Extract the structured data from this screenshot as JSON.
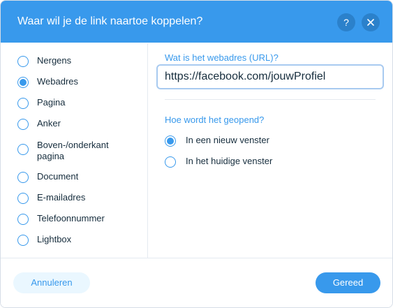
{
  "header": {
    "title": "Waar wil je de link naartoe koppelen?",
    "help_label": "?",
    "help_icon": "help-icon",
    "close_icon": "close-icon",
    "background_color": "#3899ec"
  },
  "link_types": {
    "selected": "Webadres",
    "items": [
      {
        "label": "Nergens",
        "checked": false
      },
      {
        "label": "Webadres",
        "checked": true
      },
      {
        "label": "Pagina",
        "checked": false
      },
      {
        "label": "Anker",
        "checked": false
      },
      {
        "label": "Boven-/onderkant pagina",
        "checked": false
      },
      {
        "label": "Document",
        "checked": false
      },
      {
        "label": "E-mailadres",
        "checked": false
      },
      {
        "label": "Telefoonnummer",
        "checked": false
      },
      {
        "label": "Lightbox",
        "checked": false
      }
    ]
  },
  "url_section": {
    "label": "Wat is het webadres (URL)?",
    "value": "https://facebook.com/jouwProfiel"
  },
  "open_section": {
    "label": "Hoe wordt het geopend?",
    "selected": "In een nieuw venster",
    "options": [
      {
        "label": "In een nieuw venster",
        "checked": true
      },
      {
        "label": "In het huidige venster",
        "checked": false
      }
    ]
  },
  "footer": {
    "cancel_label": "Annuleren",
    "done_label": "Gereed"
  },
  "colors": {
    "accent": "#3899ec",
    "text": "#162d3d",
    "cancel_bg": "#eaf7ff"
  }
}
